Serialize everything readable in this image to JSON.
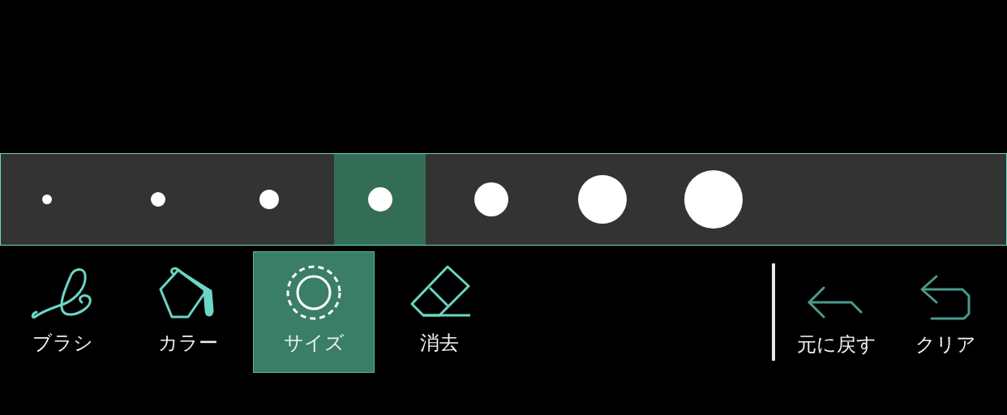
{
  "size_bar": {
    "sizes": [
      {
        "selected": false
      },
      {
        "selected": false
      },
      {
        "selected": false
      },
      {
        "selected": true
      },
      {
        "selected": false
      },
      {
        "selected": false
      },
      {
        "selected": false
      }
    ]
  },
  "tools": [
    {
      "kind": "brush",
      "label": "ブラシ",
      "selected": false
    },
    {
      "kind": "color",
      "label": "カラー",
      "selected": false
    },
    {
      "kind": "size",
      "label": "サイズ",
      "selected": true
    },
    {
      "kind": "eraser",
      "label": "消去",
      "selected": false
    }
  ],
  "actions": [
    {
      "kind": "undo",
      "label": "元に戻す"
    },
    {
      "kind": "clear",
      "label": "クリア"
    }
  ]
}
